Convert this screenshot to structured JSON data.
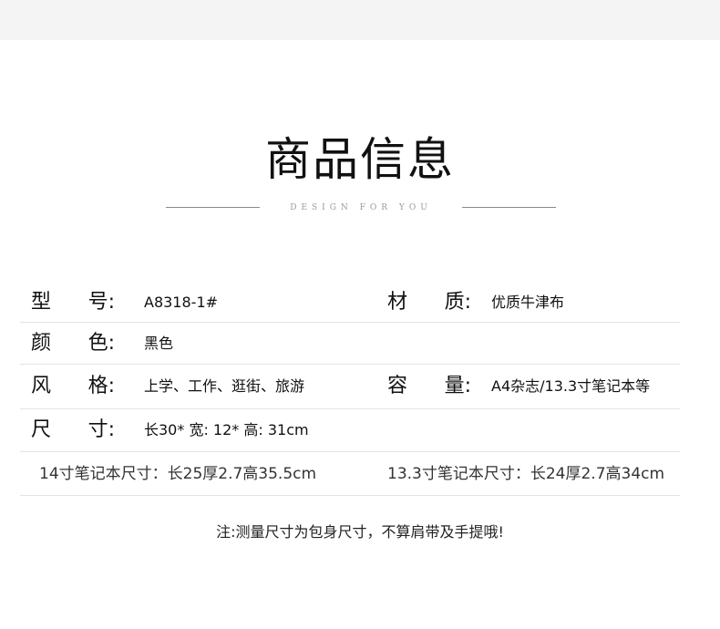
{
  "header": {
    "title": "商品信息",
    "subtitle": "DESIGN FOR YOU"
  },
  "specs": [
    {
      "label_a": "型",
      "label_b": "号:",
      "value": "A8318-1#",
      "label2_a": "材",
      "label2_b": "质:",
      "value2": "优质牛津布"
    },
    {
      "label_a": "颜",
      "label_b": "色:",
      "value": "黑色"
    },
    {
      "label_a": "风",
      "label_b": "格:",
      "value": "上学、工作、逛街、旅游",
      "label2_a": "容",
      "label2_b": "量:",
      "value2": "A4杂志/13.3寸笔记本等"
    },
    {
      "label_a": "尺",
      "label_b": "寸:",
      "value": "长30* 宽: 12* 高: 31cm"
    }
  ],
  "sizes": {
    "left": "14寸笔记本尺寸：长25厚2.7高35.5cm",
    "right": "13.3寸笔记本尺寸：长24厚2.7高34cm"
  },
  "note": "注:测量尺寸为包身尺寸，不算肩带及手提哦!"
}
